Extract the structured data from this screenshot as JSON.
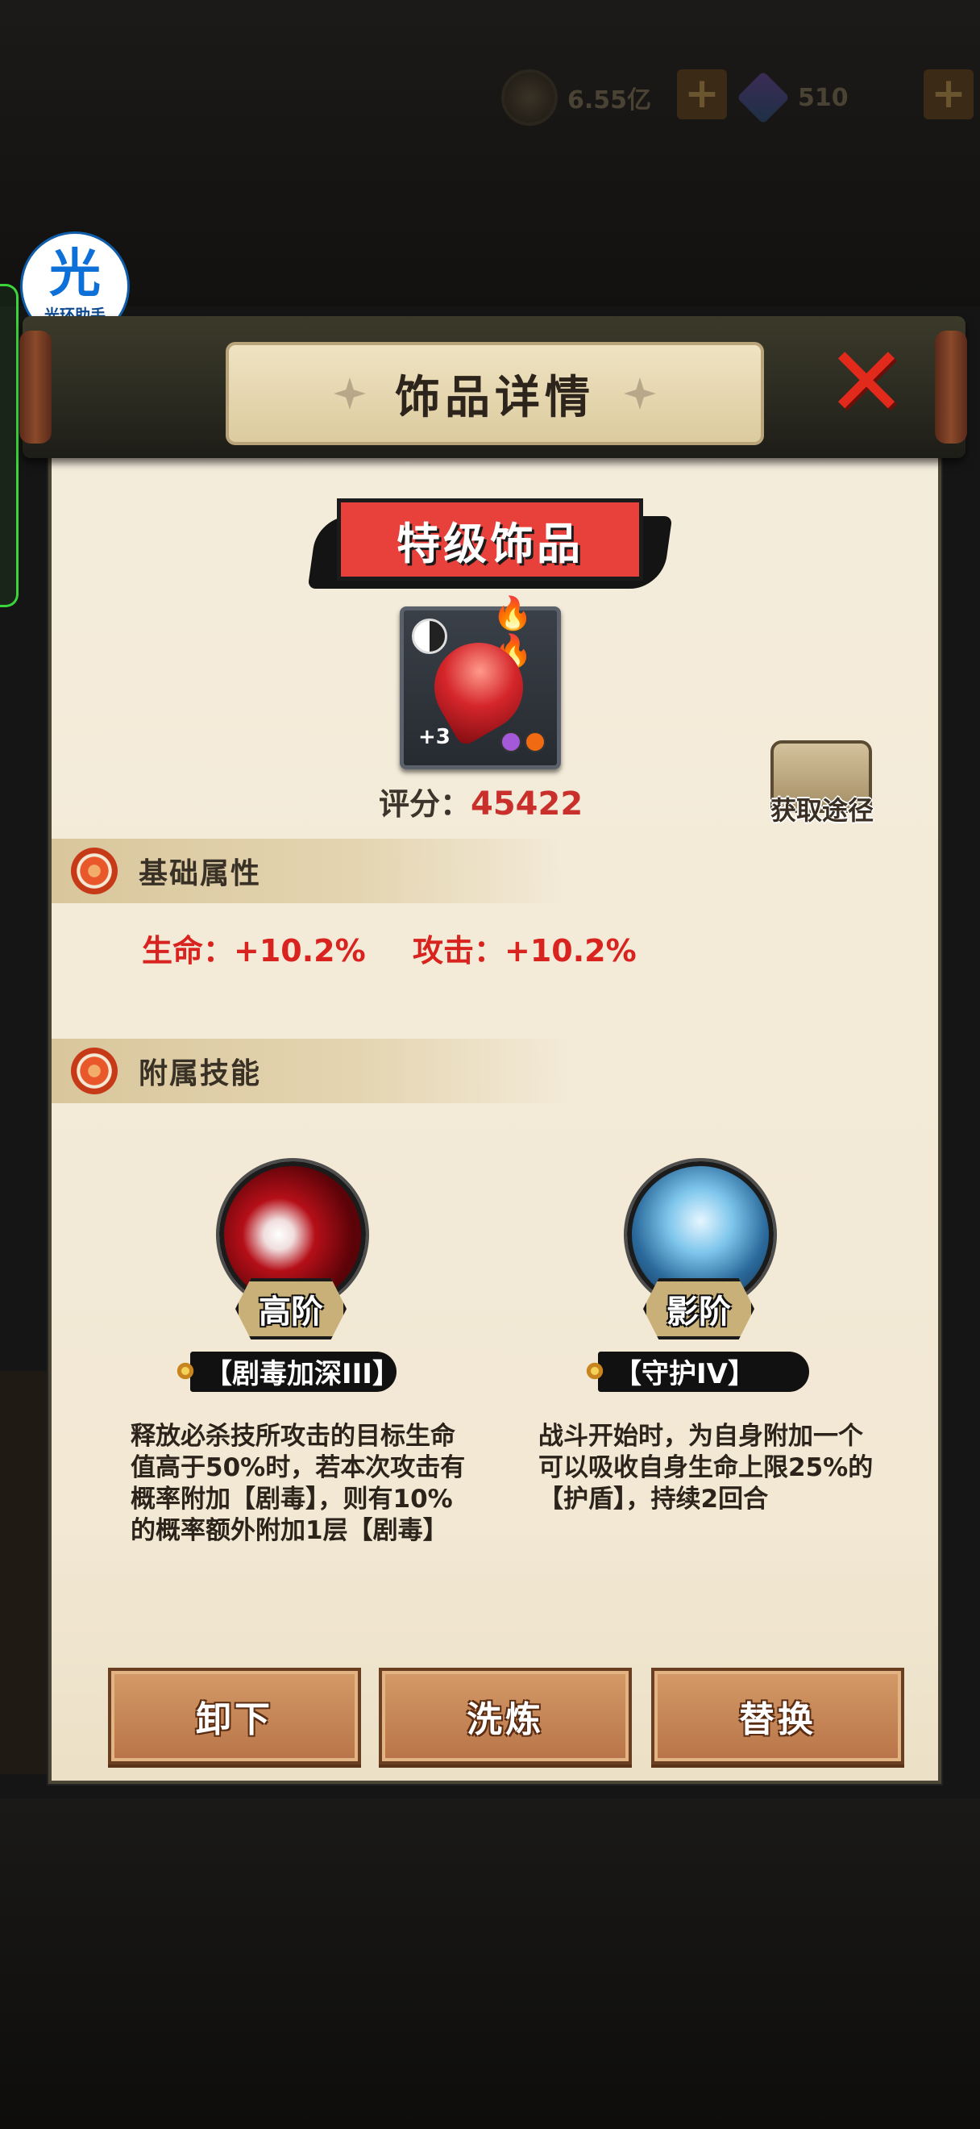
{
  "currency": {
    "coins": "6.55亿",
    "gems": "510",
    "plus": "+"
  },
  "helper": {
    "char": "光",
    "label": "光环助手"
  },
  "dialog": {
    "title": "饰品详情",
    "close": "✕"
  },
  "item": {
    "rank": "特级饰品",
    "level": "+3",
    "flames": "🔥🔥",
    "score_label": "评分：",
    "score_value": "45422"
  },
  "source": {
    "label": "获取途径"
  },
  "base_attrs": {
    "header": "基础属性",
    "hp": "生命：+10.2%",
    "attack": "攻击：+10.2%"
  },
  "skills": {
    "header": "附属技能",
    "list": [
      {
        "tier": "高阶",
        "name": "【剧毒加深III】",
        "desc": "释放必杀技所攻击的目标生命值高于50%时，若本次攻击有概率附加【剧毒】，则有10%的概率额外附加1层【剧毒】"
      },
      {
        "tier": "影阶",
        "name": "【守护IV】",
        "desc": "战斗开始时，为自身附加一个可以吸收自身生命上限25%的【护盾】，持续2回合"
      }
    ]
  },
  "buttons": {
    "unequip": "卸下",
    "refine": "洗炼",
    "replace": "替换"
  },
  "colors": {
    "accent_red": "#d8231f",
    "button_wood": "#c48655",
    "paper": "#f2e8d4"
  }
}
